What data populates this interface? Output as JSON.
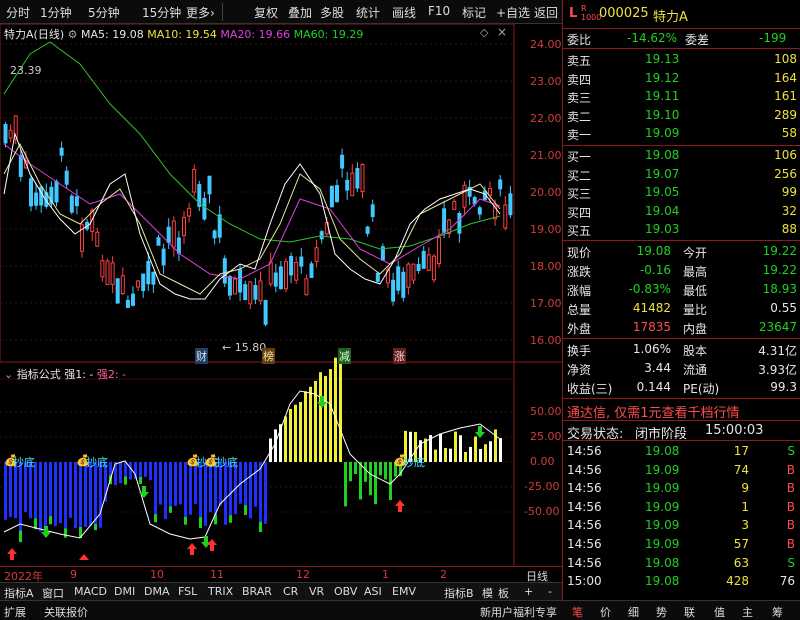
{
  "toolbar": {
    "items": [
      "分时",
      "1分钟",
      "5分钟",
      "15分钟",
      "更多›",
      "复权",
      "叠加",
      "多股",
      "统计",
      "画线",
      "F10",
      "标记",
      "+自选",
      "返回"
    ]
  },
  "chart": {
    "title": "特力A(日线)",
    "ma5": "MA5: 19.08",
    "ma10": "MA10: 19.54",
    "ma20": "MA20: 19.66",
    "ma60": "MA60: 19.29",
    "price_axis": [
      "24.00",
      "23.00",
      "22.00",
      "21.00",
      "20.00",
      "19.00",
      "18.00",
      "17.00",
      "16.00"
    ],
    "high_label": "23.39",
    "low_label": "15.80",
    "event_tags": [
      "财",
      "榜",
      "减",
      "涨"
    ]
  },
  "indicator": {
    "title": "指标公式",
    "strong1": "强1: -",
    "strong2": "强2: -",
    "axis": [
      "50.00",
      "25.00",
      "0.00",
      "-25.00",
      "-50.00"
    ],
    "tag": "抄底"
  },
  "timeline": {
    "labels": [
      "2022年",
      "9",
      "10",
      "11",
      "12",
      "1",
      "2"
    ],
    "right_label": "日线"
  },
  "tabs": [
    "指标A",
    "窗口",
    "MACD",
    "DMI",
    "DMA",
    "FSL",
    "TRIX",
    "BRAR",
    "CR",
    "VR",
    "OBV",
    "ASI",
    "EMV",
    "指标B",
    "模",
    "板",
    "+",
    "-"
  ],
  "footer": {
    "left": [
      "扩展",
      "关联报价"
    ],
    "promo": "新用户福利专享",
    "nav": [
      "笔",
      "价",
      "细",
      "势",
      "联",
      "值",
      "主",
      "筹"
    ]
  },
  "quote": {
    "code": "000025",
    "name": "特力A",
    "webi_label": "委比",
    "webi": "-14.62%",
    "weicha_label": "委差",
    "weicha": "-199",
    "asks": [
      {
        "label": "卖五",
        "price": "19.13",
        "vol": "108"
      },
      {
        "label": "卖四",
        "price": "19.12",
        "vol": "164"
      },
      {
        "label": "卖三",
        "price": "19.11",
        "vol": "161"
      },
      {
        "label": "卖二",
        "price": "19.10",
        "vol": "289"
      },
      {
        "label": "卖一",
        "price": "19.09",
        "vol": "58"
      }
    ],
    "bids": [
      {
        "label": "买一",
        "price": "19.08",
        "vol": "106"
      },
      {
        "label": "买二",
        "price": "19.07",
        "vol": "256"
      },
      {
        "label": "买三",
        "price": "19.05",
        "vol": "99"
      },
      {
        "label": "买四",
        "price": "19.04",
        "vol": "32"
      },
      {
        "label": "买五",
        "price": "19.03",
        "vol": "88"
      }
    ],
    "stats": [
      {
        "l1": "现价",
        "v1": "19.08",
        "l2": "今开",
        "v2": "19.22"
      },
      {
        "l1": "涨跌",
        "v1": "-0.16",
        "l2": "最高",
        "v2": "19.22"
      },
      {
        "l1": "涨幅",
        "v1": "-0.83%",
        "l2": "最低",
        "v2": "18.93"
      },
      {
        "l1": "总量",
        "v1": "41482",
        "l2": "量比",
        "v2": "0.55"
      },
      {
        "l1": "外盘",
        "v1": "17835",
        "l2": "内盘",
        "v2": "23647"
      }
    ],
    "stats2": [
      {
        "l1": "换手",
        "v1": "1.06%",
        "l2": "股本",
        "v2": "4.31亿"
      },
      {
        "l1": "净资",
        "v1": "3.44",
        "l2": "流通",
        "v2": "3.93亿"
      },
      {
        "l1": "收益(三)",
        "v1": "0.144",
        "l2": "PE(动)",
        "v2": "99.3"
      }
    ],
    "promo": "通达信, 仅需1元查看千档行情",
    "trade_status_label": "交易状态:",
    "trade_status": "闭市阶段",
    "trade_time": "15:00:03",
    "ticks": [
      {
        "t": "14:56",
        "p": "19.08",
        "v": "17",
        "s": "S"
      },
      {
        "t": "14:56",
        "p": "19.09",
        "v": "74",
        "s": "B"
      },
      {
        "t": "14:56",
        "p": "19.09",
        "v": "9",
        "s": "B"
      },
      {
        "t": "14:56",
        "p": "19.09",
        "v": "1",
        "s": "B"
      },
      {
        "t": "14:56",
        "p": "19.09",
        "v": "3",
        "s": "B"
      },
      {
        "t": "14:56",
        "p": "19.09",
        "v": "57",
        "s": "B"
      },
      {
        "t": "14:56",
        "p": "19.08",
        "v": "63",
        "s": "S"
      },
      {
        "t": "15:00",
        "p": "19.08",
        "v": "428",
        "s": "76"
      }
    ]
  }
}
